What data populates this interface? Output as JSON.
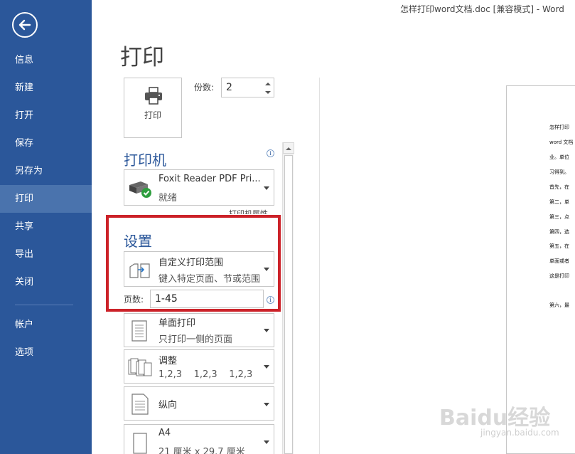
{
  "window_title": "怎样打印word文档.doc [兼容模式] - Word",
  "page_title": "打印",
  "nav": {
    "items": [
      "信息",
      "新建",
      "打开",
      "保存",
      "另存为",
      "打印",
      "共享",
      "导出",
      "关闭"
    ],
    "bottom_items": [
      "帐户",
      "选项"
    ],
    "active": "打印"
  },
  "print_button": {
    "label": "打印"
  },
  "copies": {
    "label": "份数:",
    "value": "2"
  },
  "printer": {
    "section_title": "打印机",
    "name": "Foxit Reader PDF Pri...",
    "status": "就绪",
    "properties_link": "打印机属性"
  },
  "settings": {
    "section_title": "设置",
    "range": {
      "title": "自定义打印范围",
      "subtitle": "键入特定页面、节或范围"
    },
    "pages": {
      "label": "页数:",
      "value": "1-45"
    },
    "sides": {
      "title": "单面打印",
      "subtitle": "只打印一侧的页面"
    },
    "collate": {
      "title": "调整",
      "subtitle": "1,2,3    1,2,3    1,2,3"
    },
    "orientation": {
      "title": "纵向"
    },
    "paper": {
      "title": "A4",
      "subtitle": "21 厘米 x 29.7 厘米"
    }
  },
  "preview": {
    "lines": [
      "怎样打印",
      "word 文档",
      "业。单位",
      "习得到。",
      "首先，在",
      "第二，单",
      "第三，点",
      "第四，选",
      "第五，在",
      "单面或者",
      "这是打印",
      "第六，最"
    ]
  },
  "watermark": {
    "logo": "Baidu经验",
    "url": "jingyan.baidu.com"
  },
  "colors": {
    "nav_bg": "#2b579a",
    "nav_active": "#4a73ad",
    "highlight": "#cc2229",
    "section": "#2b579a"
  }
}
